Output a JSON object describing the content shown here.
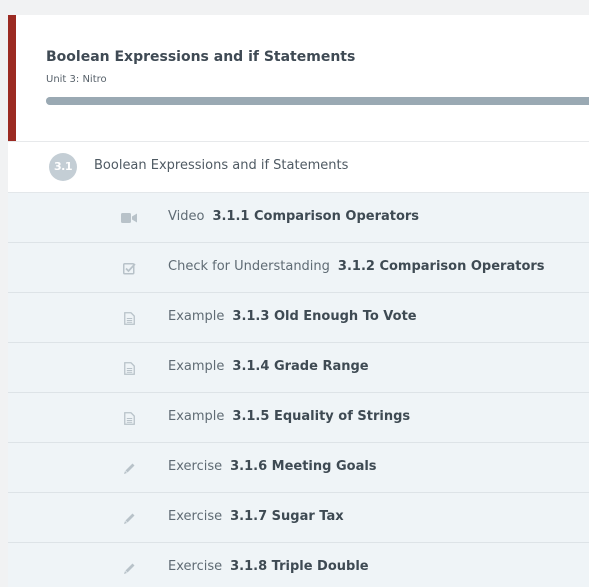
{
  "header": {
    "title": "Boolean Expressions and if Statements",
    "unit": "Unit 3: Nitro",
    "accent_color": "#9b2a22",
    "progress_fraction": 1.0
  },
  "section": {
    "number": "3.1",
    "title": "Boolean Expressions and if Statements"
  },
  "items": [
    {
      "icon": "video-camera-icon",
      "type": "Video",
      "name": "3.1.1 Comparison Operators"
    },
    {
      "icon": "checkbox-icon",
      "type": "Check for Understanding",
      "name": "3.1.2 Comparison Operators"
    },
    {
      "icon": "document-icon",
      "type": "Example",
      "name": "3.1.3 Old Enough To Vote"
    },
    {
      "icon": "document-icon",
      "type": "Example",
      "name": "3.1.4 Grade Range"
    },
    {
      "icon": "document-icon",
      "type": "Example",
      "name": "3.1.5 Equality of Strings"
    },
    {
      "icon": "pencil-icon",
      "type": "Exercise",
      "name": "3.1.6 Meeting Goals"
    },
    {
      "icon": "pencil-icon",
      "type": "Exercise",
      "name": "3.1.7 Sugar Tax"
    },
    {
      "icon": "pencil-icon",
      "type": "Exercise",
      "name": "3.1.8 Triple Double"
    }
  ]
}
